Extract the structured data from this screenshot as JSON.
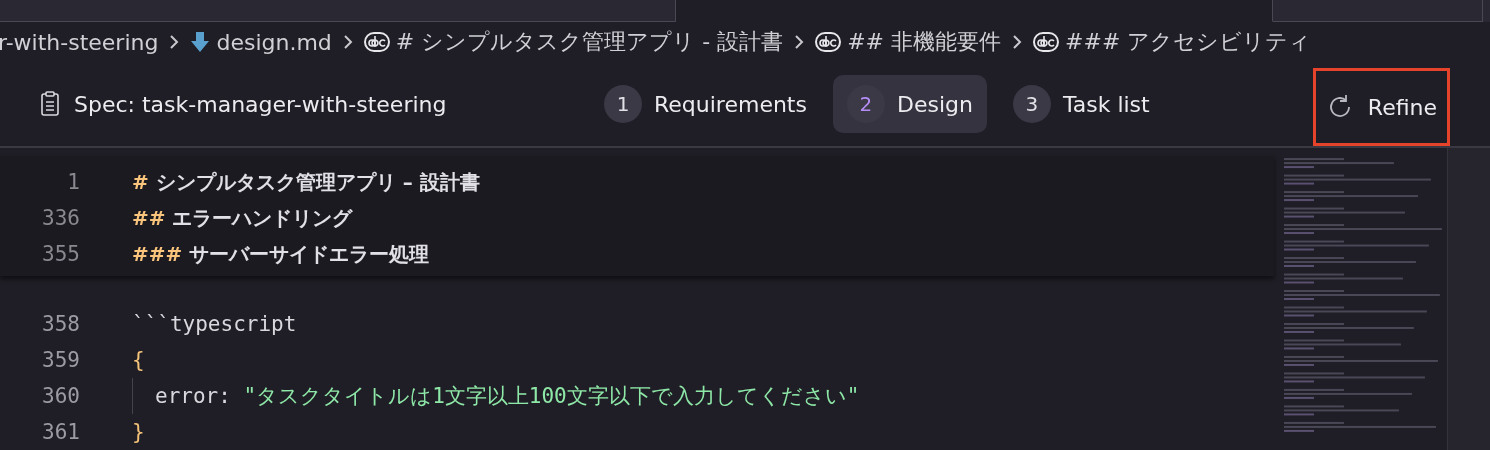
{
  "editor_tabs": [
    {
      "selected": false
    },
    {
      "selected": true
    },
    {
      "selected": false
    }
  ],
  "breadcrumb": [
    {
      "kind": "folder",
      "label": "r-with-steering"
    },
    {
      "kind": "file",
      "label": "design.md"
    },
    {
      "kind": "heading",
      "label": "# シンプルタスク管理アプリ - 設計書"
    },
    {
      "kind": "heading",
      "label": "## 非機能要件"
    },
    {
      "kind": "heading",
      "label": "### アクセシビリティ"
    }
  ],
  "spec": {
    "title": "Spec: task-manager-with-steering",
    "steps": [
      {
        "number": "1",
        "label": "Requirements",
        "selected": false
      },
      {
        "number": "2",
        "label": "Design",
        "selected": true
      },
      {
        "number": "3",
        "label": "Task list",
        "selected": false
      }
    ],
    "refine": {
      "label": "Refine",
      "highlighted": true
    }
  },
  "sticky_lines": [
    {
      "line": "1",
      "marker": "#",
      "text": "シンプルタスク管理アプリ – 設計書"
    },
    {
      "line": "336",
      "marker": "##",
      "text": "エラーハンドリング"
    },
    {
      "line": "355",
      "marker": "###",
      "text": "サーバーサイドエラー処理"
    }
  ],
  "code_lines": [
    {
      "line": "358",
      "tokens": [
        {
          "kind": "plain",
          "text": "```typescript"
        }
      ]
    },
    {
      "line": "359",
      "tokens": [
        {
          "kind": "brace",
          "text": "{"
        }
      ]
    },
    {
      "line": "360",
      "indent": true,
      "tokens": [
        {
          "kind": "plain",
          "text": "error: "
        },
        {
          "kind": "string",
          "text": "\"タスクタイトルは1文字以上100文字以下で入力してください\""
        }
      ]
    },
    {
      "line": "361",
      "tokens": [
        {
          "kind": "brace",
          "text": "}"
        }
      ]
    }
  ]
}
